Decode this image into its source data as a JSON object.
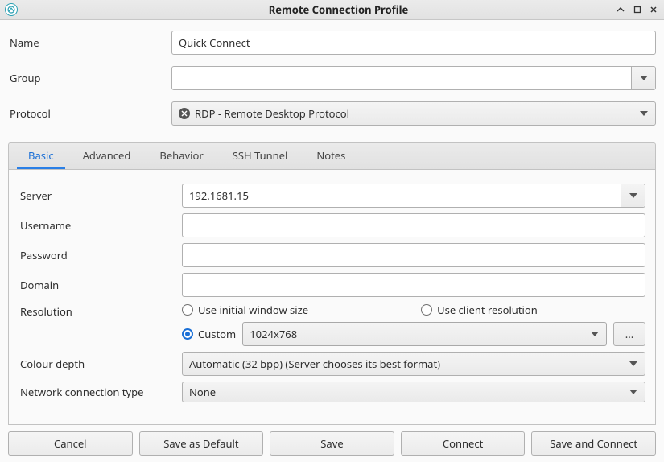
{
  "window": {
    "title": "Remote Connection Profile"
  },
  "header": {
    "name_label": "Name",
    "name_value": "Quick Connect",
    "group_label": "Group",
    "group_value": "",
    "protocol_label": "Protocol",
    "protocol_value": "RDP - Remote Desktop Protocol"
  },
  "tabs": {
    "basic": "Basic",
    "advanced": "Advanced",
    "behavior": "Behavior",
    "ssh_tunnel": "SSH Tunnel",
    "notes": "Notes"
  },
  "basic": {
    "server_label": "Server",
    "server_value": "192.1681.15",
    "username_label": "Username",
    "username_value": "",
    "password_label": "Password",
    "password_value": "",
    "domain_label": "Domain",
    "domain_value": "",
    "resolution_label": "Resolution",
    "res_initial": "Use initial window size",
    "res_client": "Use client resolution",
    "res_custom_label": "Custom",
    "res_custom_value": "1024x768",
    "res_custom_selected": true,
    "more_label": "...",
    "colour_depth_label": "Colour depth",
    "colour_depth_value": "Automatic (32 bpp) (Server chooses its best format)",
    "net_type_label": "Network connection type",
    "net_type_value": "None"
  },
  "buttons": {
    "cancel": "Cancel",
    "save_default": "Save as Default",
    "save": "Save",
    "connect": "Connect",
    "save_connect": "Save and Connect"
  }
}
